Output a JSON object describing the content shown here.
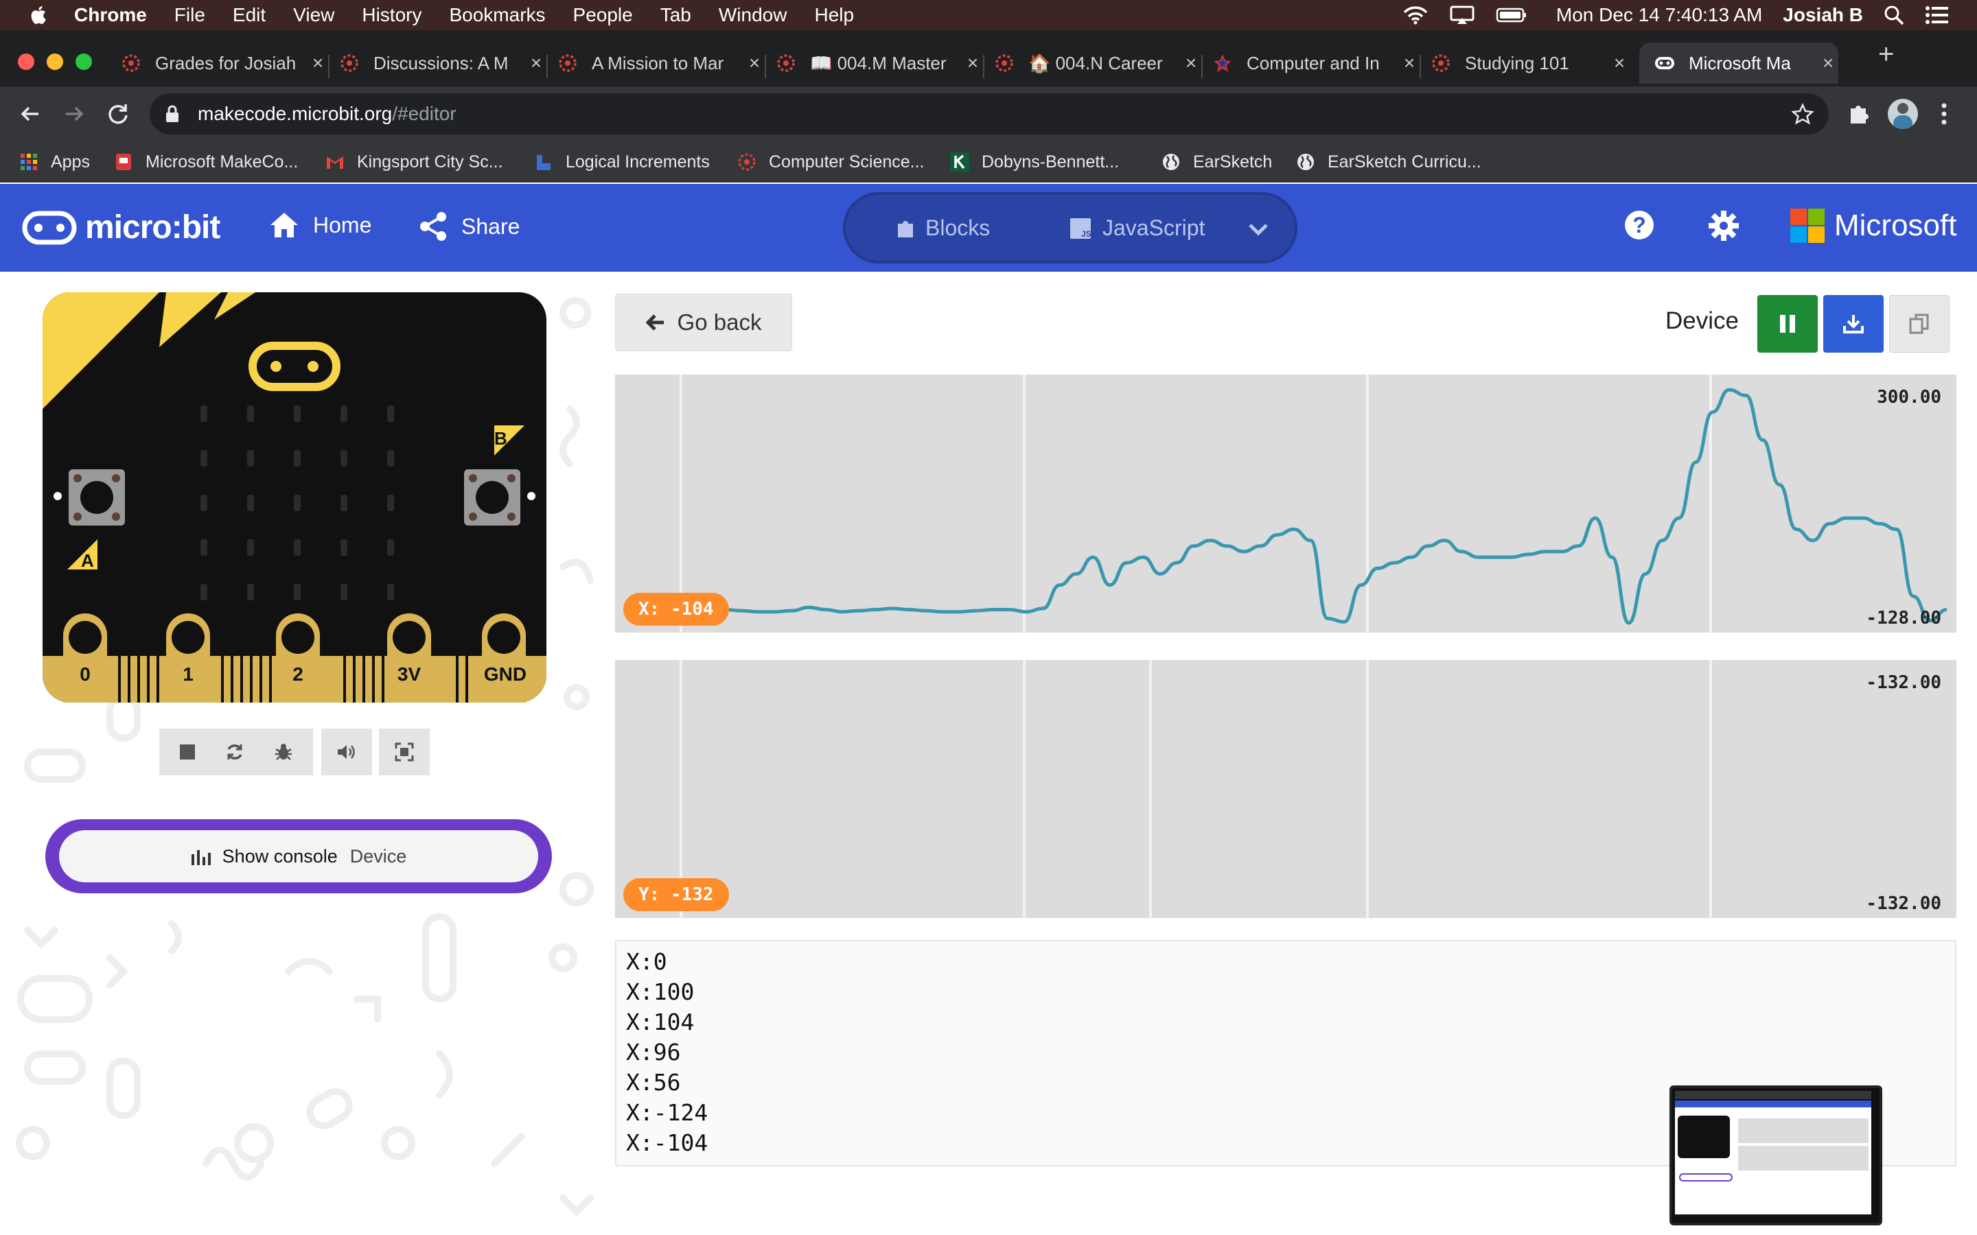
{
  "menubar": {
    "app": "Chrome",
    "menus": [
      "File",
      "Edit",
      "View",
      "History",
      "Bookmarks",
      "People",
      "Tab",
      "Window",
      "Help"
    ],
    "datetime": "Mon Dec 14  7:40:13 AM",
    "user": "Josiah B"
  },
  "tabs": [
    {
      "label": "Grades for Josiah",
      "icon": "canvas-icon"
    },
    {
      "label": "Discussions: A M",
      "icon": "canvas-icon"
    },
    {
      "label": "A Mission to Mar",
      "icon": "canvas-icon"
    },
    {
      "label": "📖 004.M Master",
      "icon": "canvas-icon"
    },
    {
      "label": "🏠 004.N Career",
      "icon": "canvas-icon"
    },
    {
      "label": "Computer and In",
      "icon": "star-icon"
    },
    {
      "label": "Studying 101",
      "icon": "canvas-icon"
    },
    {
      "label": "Microsoft Ma",
      "icon": "microbit-icon",
      "active": true
    }
  ],
  "address": {
    "host": "makecode.microbit.org",
    "path": "/#editor"
  },
  "bookmarks": [
    {
      "label": "Apps",
      "icon": "apps-grid-icon"
    },
    {
      "label": "Microsoft MakeCo...",
      "icon": "makecode-icon"
    },
    {
      "label": "Kingsport City Sc...",
      "icon": "gmail-icon"
    },
    {
      "label": "Logical Increments",
      "icon": "logical-increments-icon"
    },
    {
      "label": "Computer Science...",
      "icon": "canvas-icon"
    },
    {
      "label": "Dobyns-Bennett...",
      "icon": "k-icon"
    },
    {
      "label": "EarSketch",
      "icon": "globe-icon"
    },
    {
      "label": "EarSketch Curricu...",
      "icon": "globe-icon"
    }
  ],
  "makecode": {
    "brand": "micro:bit",
    "home": "Home",
    "share": "Share",
    "blocks": "Blocks",
    "javascript": "JavaScript",
    "microsoft": "Microsoft"
  },
  "simulator": {
    "pins": [
      "0",
      "1",
      "2",
      "3V",
      "GND"
    ],
    "button_a": "A",
    "button_b": "B",
    "show_console": "Show console",
    "console_source": "Device"
  },
  "serial": {
    "go_back": "Go back",
    "device_label": "Device",
    "charts": [
      {
        "badge": "X: -104",
        "max": "300.00",
        "min": "-128.00"
      },
      {
        "badge": "Y: -132",
        "max": "-132.00",
        "min": "-132.00"
      }
    ],
    "console_lines": [
      "X:0",
      "X:100",
      "X:104",
      "X:96",
      "X:56",
      "X:-124",
      "X:-104"
    ]
  },
  "chart_data": {
    "type": "line",
    "series": [
      {
        "name": "X",
        "values": [
          -104,
          -106,
          -108,
          -108,
          -106,
          -100,
          -104,
          -108,
          -106,
          -104,
          -102,
          -104,
          -106,
          -108,
          -108,
          -106,
          -104,
          -104,
          -108,
          -102,
          -60,
          -40,
          -10,
          -60,
          -20,
          -10,
          -40,
          -20,
          10,
          20,
          10,
          0,
          10,
          30,
          40,
          20,
          -120,
          -126,
          -60,
          -30,
          -20,
          -10,
          10,
          20,
          0,
          -10,
          -10,
          -10,
          -5,
          0,
          0,
          10,
          60,
          -10,
          -128,
          -40,
          20,
          60,
          160,
          250,
          290,
          280,
          200,
          120,
          40,
          20,
          50,
          60,
          60,
          50,
          40,
          -80,
          -124,
          -104
        ]
      },
      {
        "name": "Y",
        "values": [
          -132,
          -132,
          -132,
          -132,
          -132,
          -132,
          -132,
          -132,
          -132,
          -132
        ]
      }
    ],
    "ylim_x": [
      -128,
      300
    ],
    "ylim_y": [
      -132,
      -132
    ]
  },
  "colors": {
    "header": "#3454d1",
    "toggle": "#2a44a6",
    "console_ring": "#6c3cc9",
    "badge": "#ff8c2a",
    "line": "#3a97ad",
    "pause_button": "#1d8a36",
    "download_button": "#2f5fd6"
  }
}
